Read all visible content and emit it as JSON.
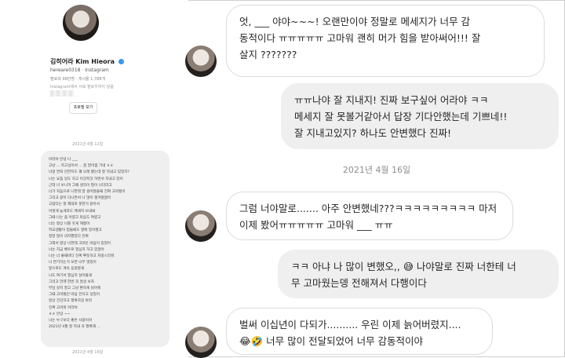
{
  "profile": {
    "name": "김히어라 Kim Hieora",
    "handle": "hereare0318 · Instagram",
    "stats": "팔로워 98만명 · 게시물 1,788개",
    "note": "Instagram에서 서로 팔로우하지 않음",
    "view_profile_label": "프로필 보기",
    "date_top": "2021년 4월 12일",
    "date_bottom": "2021년 4월 16일",
    "mini_lines": [
      "어라야 안녕 나 ___",
      "고냥 ... 하고싶어서 ... 흠 말이좀 기네 ㅎㅎ",
      "너랑 연락 안한지도 꽤 오래 됐는데 잘 지내고 있었지?",
      "나는 요즘 일도 하고 이것저것 하면서 지내고 있어",
      "근데 너 보니까 그때 생각이 많이 나더라고",
      "너가 처음으로 나한테 말 걸어줬을때 진짜 고마웠어",
      "그리고 같이 다니면서 나 많이 챙겨줬잖아",
      "고맙다는 말 제대로 못한거 같아서",
      "이렇게 늦게라도 메세지 보내봐",
      "그때 나는 좀 어렸고 마음도 여렸고",
      "너는 항상 나를 웃게 해줬어",
      "학교생활이 힘들때도 옆에 있어줬고",
      "정말 많이 의지했었다 진짜",
      "그래서 항상 너한테 고마운 마음이 있었어",
      "너는 지금 배우로 열심히 하고 있잖아",
      "나는 너 볼때마다 진짜 뿌듯하고 자랑스러워",
      "너 연기하는거 보면 너무 멋있어",
      "앞으로도 계속 응원할게",
      "나도 여기서 열심히 살아볼게",
      "그리고 언제 한번 꼭 얼굴 보자",
      "부담 갖지 말고 그냥 편하게 읽어줘",
      "그때 고마웠던 마음 전하고 싶었어",
      "항상 건강하고 행복하길 바라",
      "진짜 고마워 어라야",
      "ㅎㅎ 안녕 ~~",
      "너는 누구보다 좋은 사람이야",
      "2021년 4월 잘 지내 꼭 행복해 ..."
    ]
  },
  "chat": {
    "date_label": "2021년 4월 16일",
    "messages": [
      {
        "sender": "other",
        "lines": [
          "엇, ___ 야야~~~! 오랜만이야 정말로 메세지가 너무 감",
          "동적이다 ㅠㅠㅠㅠㅠ 고마워 괜히 머가 힘을 받아써어!!! 잘",
          "살지 ???????"
        ]
      },
      {
        "sender": "me",
        "lines": [
          "ㅠㅠ나야 잘 지내지! 진짜 보구싶어 어라야 ㅋㅋ",
          "메세지 잘 못볼거같아서 답장 기다안했는데 기쁘네!!",
          "잘 지내고있지? 하나도 안변했다 진짜!"
        ]
      },
      {
        "sender": "other",
        "lines": [
          "그럼 너야말로....... 아주 안변했네???ㅋㅋㅋㅋㅋㅋㅋㅋㅋ 마저",
          "이제 봤어ㅠㅠㅠㅠㅠ 고마워 ___ ㅠㅠ"
        ]
      },
      {
        "sender": "me",
        "lines": [
          "ㅋㅋ 아냐 나 많이 변했오,, 😅 나야말로 진짜 너한테 너",
          "무 고마웠는뎅 전해져서 다행이다"
        ]
      },
      {
        "sender": "other",
        "lines": [
          "벌써 이십년이 다되가.......... 우린 이제 늙어버렸지....",
          "😂🤣 너무 많이 전달되었어 너무 감동적이야"
        ]
      }
    ]
  },
  "colors": {
    "bubble_border": "#dbdbdb",
    "my_bubble": "#efefef",
    "date_text": "#8e8e8e",
    "verified": "#3897f0"
  }
}
